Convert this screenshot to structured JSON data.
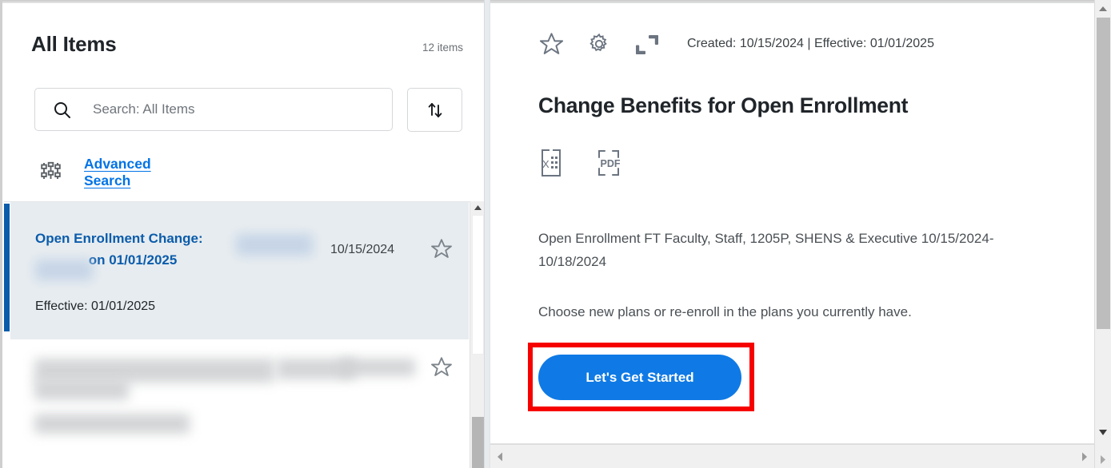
{
  "sidebar": {
    "title": "All Items",
    "item_count": "12 items",
    "search": {
      "placeholder": "Search: All Items",
      "value": "",
      "icon": "search-icon"
    },
    "sort_button": {
      "icon": "sort-arrows-icon",
      "label": ""
    },
    "advanced_search": {
      "label": "Advanced Search",
      "icon": "filter-sliders-icon"
    },
    "items": [
      {
        "title_part1": "Open Enrollment Change:",
        "title_redacted1": "",
        "title_part2": "on 01/01/2025",
        "title_redacted2": "",
        "date": "10/15/2024",
        "effective": "Effective: 01/01/2025",
        "favorite_icon": "star-outline-icon",
        "selected": true
      },
      {
        "title_part1": "",
        "title_part2": "",
        "date": "",
        "effective": "",
        "favorite_icon": "star-outline-icon",
        "selected": false,
        "redacted": true
      }
    ]
  },
  "detail": {
    "toolbar": {
      "favorite_icon": "star-outline-icon",
      "settings_icon": "gear-icon",
      "expand_icon": "expand-maximize-icon"
    },
    "meta": "Created: 10/15/2024 | Effective: 01/01/2025",
    "title": "Change Benefits for Open Enrollment",
    "exports": [
      {
        "icon": "excel-export-icon",
        "label": "X"
      },
      {
        "icon": "pdf-export-icon",
        "label": "PDF"
      }
    ],
    "body_paragraph_1": "Open Enrollment FT Faculty, Staff, 1205P, SHENS & Executive 10/15/2024-10/18/2024",
    "body_paragraph_2": "Choose new plans or re-enroll in the plans you currently have.",
    "cta_label": "Let's Get Started"
  },
  "colors": {
    "accent_blue": "#0f7ae5",
    "link_blue": "#0073e6",
    "selected_border_blue": "#0b5cab",
    "selected_row_bg": "#e7ecf0",
    "highlight_red": "#f60000",
    "text_dark": "#20252a",
    "text_muted": "#6b7176"
  },
  "scrollbars": {
    "sidebar_vertical": {
      "icon": "scroll-up-arrow-icon"
    },
    "detail_vertical": {
      "up_icon": "scroll-up-arrow-icon",
      "down_icon": "scroll-down-arrow-icon"
    },
    "detail_horizontal": {
      "left_icon": "scroll-left-arrow-icon",
      "right_icon": "scroll-right-arrow-icon"
    }
  }
}
